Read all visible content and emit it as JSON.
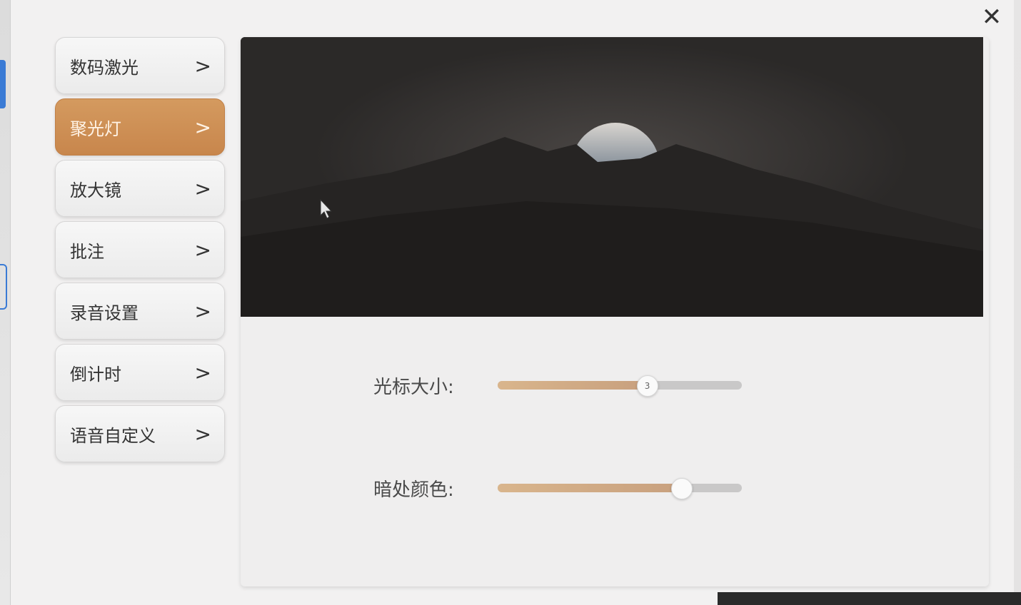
{
  "close": {
    "label": "✕"
  },
  "sidebar": {
    "items": [
      {
        "label": "数码激光",
        "chevron": ">",
        "active": false
      },
      {
        "label": "聚光灯",
        "chevron": ">",
        "active": true
      },
      {
        "label": "放大镜",
        "chevron": ">",
        "active": false
      },
      {
        "label": "批注",
        "chevron": ">",
        "active": false
      },
      {
        "label": "录音设置",
        "chevron": ">",
        "active": false
      },
      {
        "label": "倒计时",
        "chevron": ">",
        "active": false
      },
      {
        "label": "语音自定义",
        "chevron": ">",
        "active": false
      }
    ]
  },
  "settings": {
    "cursor_size": {
      "label": "光标大小:",
      "value": "3",
      "fraction": 0.61
    },
    "dark_color": {
      "label": "暗处颜色:",
      "fraction": 0.75
    }
  },
  "colors": {
    "accent": "#c8864c",
    "slider_fill": "#d2ad86",
    "preview_bg": "#2f2d2c"
  }
}
